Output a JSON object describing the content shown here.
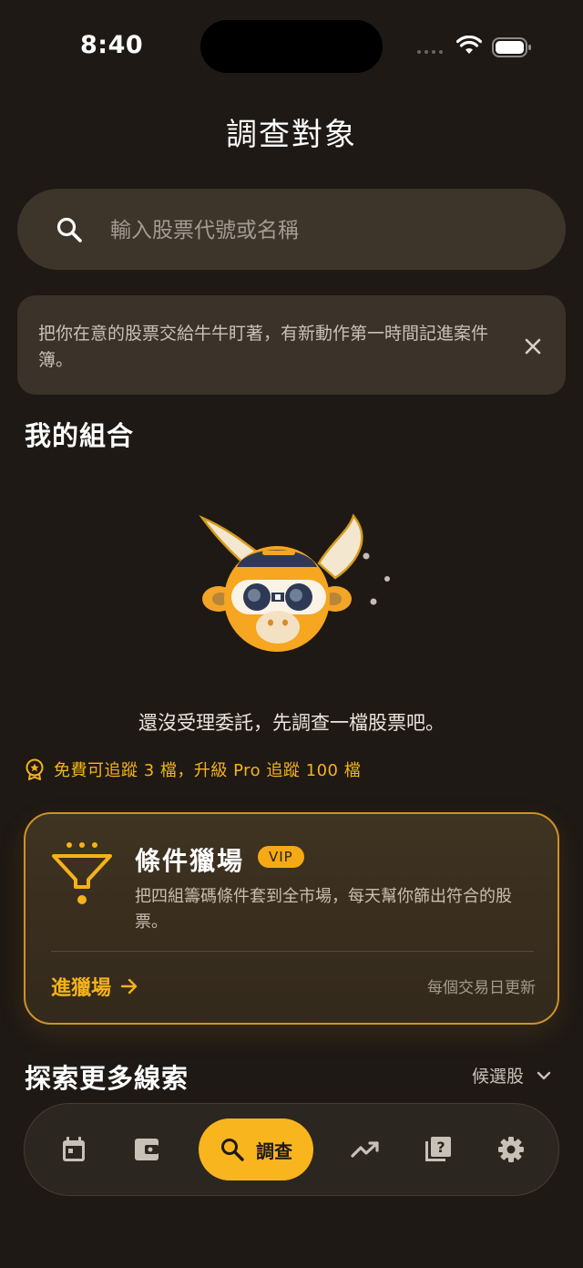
{
  "status_bar": {
    "time": "8:40"
  },
  "page": {
    "title": "調查對象"
  },
  "search": {
    "placeholder": "輸入股票代號或名稱",
    "value": ""
  },
  "banner": {
    "message": "把你在意的股票交給牛牛盯著，有新動作第一時間記進案件簿。"
  },
  "portfolio": {
    "title": "我的組合",
    "empty_message": "還沒受理委託，先調查一檔股票吧。",
    "tip": "免費可追蹤 3 檔，升級 Pro 追蹤 100 檔"
  },
  "screener_card": {
    "title": "條件獵場",
    "badge": "VIP",
    "description": "把四組籌碼條件套到全市場，每天幫你篩出符合的股票。",
    "cta": "進獵場",
    "update_note": "每個交易日更新"
  },
  "explore": {
    "title": "探索更多線索",
    "filter_label": "候選股"
  },
  "bottom_nav": {
    "items": [
      {
        "icon": "calendar-icon"
      },
      {
        "icon": "wallet-icon"
      },
      {
        "icon": "search-icon",
        "label": "調查",
        "active": true
      },
      {
        "icon": "trending-up-icon"
      },
      {
        "icon": "quiz-icon"
      },
      {
        "icon": "gear-icon"
      }
    ]
  },
  "colors": {
    "background": "#1e1915",
    "accent": "#f8b51e",
    "card_border": "#cc9227",
    "surface": "#3d342a"
  }
}
